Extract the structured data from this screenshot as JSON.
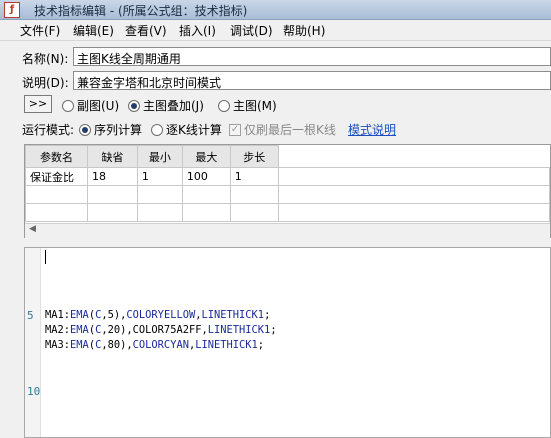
{
  "window": {
    "title": "技术指标编辑 - (所属公式组：技术指标)",
    "icon": "formula-icon"
  },
  "menu": [
    "文件(F)",
    "编辑(E)",
    "查看(V)",
    "插入(I)",
    "调试(D)",
    "帮助(H)"
  ],
  "form": {
    "name_label": "名称(N):",
    "name_value": "主图K线全周期通用",
    "desc_label": "说明(D):",
    "desc_value": "兼容金字塔和北京时间模式",
    "expand_button": ">>",
    "chart_options": [
      {
        "label": "副图(U)",
        "selected": false
      },
      {
        "label": "主图叠加(J)",
        "selected": true
      },
      {
        "label": "主图(M)",
        "selected": false
      }
    ],
    "run_mode_label": "运行模式:",
    "run_options": [
      {
        "label": "序列计算",
        "selected": true
      },
      {
        "label": "逐K线计算",
        "selected": false
      }
    ],
    "refresh_last_bar": {
      "label": "仅刷最后一根K线",
      "checked": true,
      "disabled": true
    },
    "mode_help_link": "模式说明"
  },
  "params": {
    "headers": [
      "参数名",
      "缺省",
      "最小",
      "最大",
      "步长"
    ],
    "rows": [
      [
        "保证金比",
        "18",
        "1",
        "100",
        "1"
      ]
    ]
  },
  "editor": {
    "line_numbers": {
      "line5": "5",
      "line10": "10"
    },
    "lines": [
      {
        "var": "MA1",
        "period": "5",
        "color": "COLORYELLOW",
        "thick": "LINETHICK1"
      },
      {
        "var": "MA2",
        "period": "20",
        "color": "COLOR75A2FF",
        "thick": "LINETHICK1"
      },
      {
        "var": "MA3",
        "period": "80",
        "color": "COLORCYAN",
        "thick": "LINETHICK1"
      }
    ],
    "fn": "EMA",
    "price": "C"
  }
}
